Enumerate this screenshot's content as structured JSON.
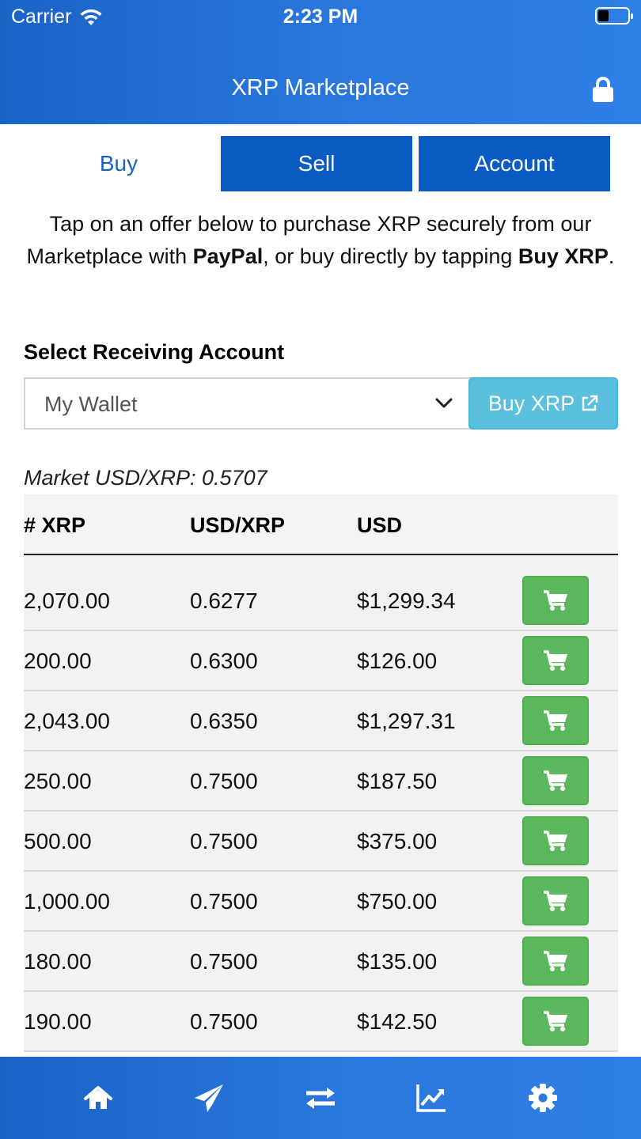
{
  "status_bar": {
    "carrier": "Carrier",
    "time": "2:23 PM"
  },
  "header": {
    "title": "XRP Marketplace"
  },
  "tabs": [
    {
      "label": "Buy",
      "active": true
    },
    {
      "label": "Sell",
      "active": false
    },
    {
      "label": "Account",
      "active": false
    }
  ],
  "intro": {
    "part1": "Tap on an offer below to purchase XRP securely from our Marketplace with ",
    "paypal": "PayPal",
    "part2": ", or buy directly by tapping ",
    "buy_xrp": "Buy XRP",
    "part3": "."
  },
  "receiving": {
    "label": "Select Receiving Account",
    "selected": "My Wallet",
    "buy_button": "Buy XRP"
  },
  "market_rate": "Market USD/XRP: 0.5707",
  "table": {
    "headers": [
      "# XRP",
      "USD/XRP",
      "USD"
    ],
    "rows": [
      {
        "xrp": "2,070.00",
        "rate": "0.6277",
        "usd": "$1,299.34"
      },
      {
        "xrp": "200.00",
        "rate": "0.6300",
        "usd": "$126.00"
      },
      {
        "xrp": "2,043.00",
        "rate": "0.6350",
        "usd": "$1,297.31"
      },
      {
        "xrp": "250.00",
        "rate": "0.7500",
        "usd": "$187.50"
      },
      {
        "xrp": "500.00",
        "rate": "0.7500",
        "usd": "$375.00"
      },
      {
        "xrp": "1,000.00",
        "rate": "0.7500",
        "usd": "$750.00"
      },
      {
        "xrp": "180.00",
        "rate": "0.7500",
        "usd": "$135.00"
      },
      {
        "xrp": "190.00",
        "rate": "0.7500",
        "usd": "$142.50"
      }
    ]
  },
  "bottom_nav": [
    {
      "icon": "home-icon"
    },
    {
      "icon": "send-icon"
    },
    {
      "icon": "exchange-icon"
    },
    {
      "icon": "chart-icon"
    },
    {
      "icon": "settings-icon"
    }
  ],
  "colors": {
    "header": "#2a78dd",
    "tab_active_text": "#1a63c6",
    "tab_inactive_bg": "#0a5bc2",
    "buy_button": "#5bc0de",
    "cart_button": "#5cb85c"
  }
}
